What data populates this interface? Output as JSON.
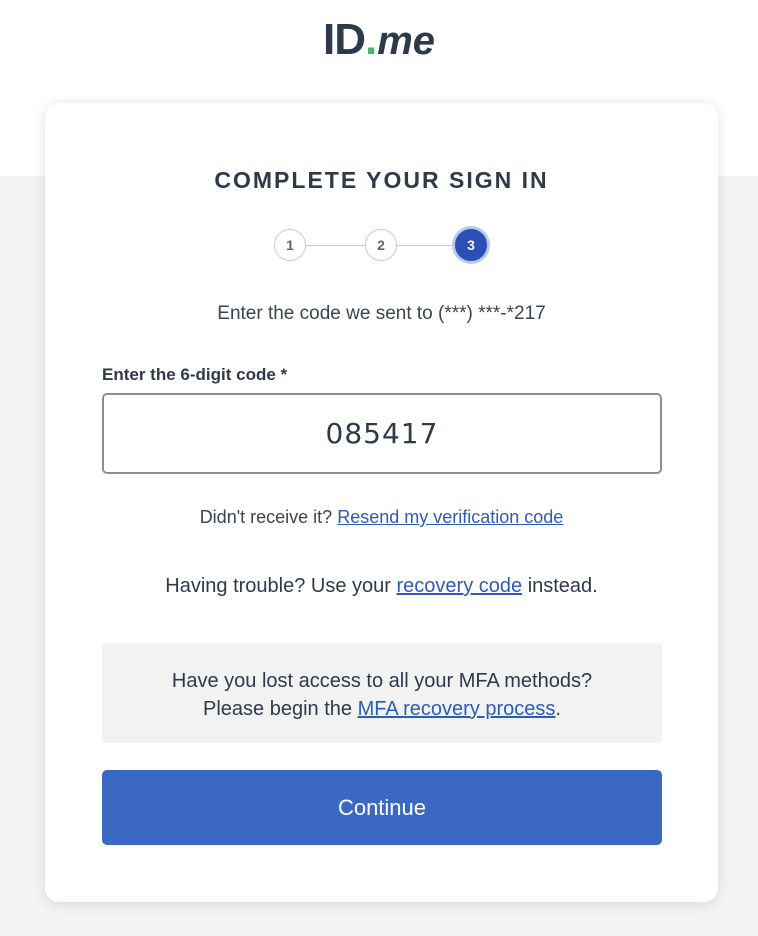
{
  "logo": {
    "id_text": "ID",
    "dot": ".",
    "me_text": "me"
  },
  "card": {
    "title": "COMPLETE YOUR SIGN IN",
    "steps": [
      {
        "label": "1",
        "active": false
      },
      {
        "label": "2",
        "active": false
      },
      {
        "label": "3",
        "active": true
      }
    ],
    "instruction": "Enter the code we sent to (***) ***-*217",
    "field_label": "Enter the 6-digit code *",
    "code_value": "085417",
    "resend_prefix": "Didn't receive it?",
    "resend_link": "Resend my verification code",
    "trouble_prefix": "Having trouble? Use your",
    "trouble_link": "recovery code",
    "trouble_suffix": "instead.",
    "mfa_line1": "Have you lost access to all your MFA methods?",
    "mfa_line2_prefix": "Please begin the",
    "mfa_link": "MFA recovery process",
    "mfa_line2_suffix": ".",
    "continue_label": "Continue"
  },
  "colors": {
    "primary_button": "#3b68c2",
    "active_step": "#2b4fb4",
    "link": "#2b5cb8",
    "logo_dot": "#4db66a"
  }
}
